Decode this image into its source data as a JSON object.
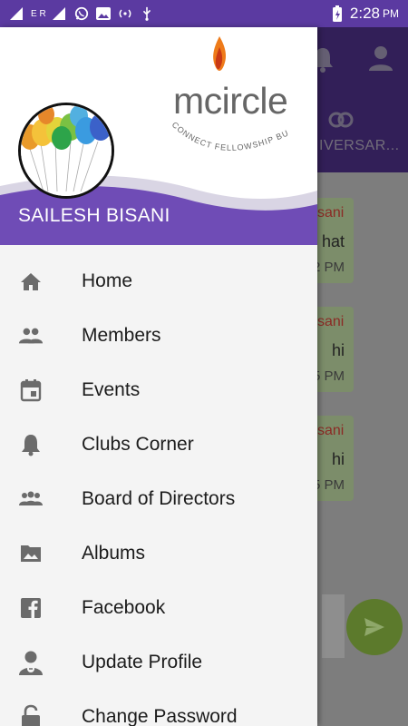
{
  "status_bar": {
    "network_label": "E R",
    "time": "2:28",
    "ampm": "PM"
  },
  "app": {
    "tab_label": "IVERSAR...",
    "messages": [
      {
        "name": "sani",
        "text": "hat",
        "time": "2 PM"
      },
      {
        "name": "sani",
        "text": "hi",
        "time": "5 PM"
      },
      {
        "name": "sani",
        "text": "hi",
        "time": "5 PM"
      }
    ]
  },
  "drawer": {
    "logo": {
      "brand": "mcircle",
      "tagline": "CONNECT FELLOWSHIP BUSINESS"
    },
    "user_name": "SAILESH BISANI",
    "menu": [
      {
        "label": "Home",
        "icon": "home-icon"
      },
      {
        "label": "Members",
        "icon": "members-icon"
      },
      {
        "label": "Events",
        "icon": "calendar-icon"
      },
      {
        "label": "Clubs Corner",
        "icon": "bell-icon"
      },
      {
        "label": "Board of Directors",
        "icon": "group-icon"
      },
      {
        "label": "Albums",
        "icon": "image-icon"
      },
      {
        "label": "Facebook",
        "icon": "facebook-icon"
      },
      {
        "label": "Update Profile",
        "icon": "user-edit-icon"
      },
      {
        "label": "Change Password",
        "icon": "unlock-icon"
      }
    ]
  },
  "colors": {
    "primary": "#5b3aa1",
    "drawer_bg": "#f4f4f4",
    "send_button": "#5c7a2c"
  }
}
